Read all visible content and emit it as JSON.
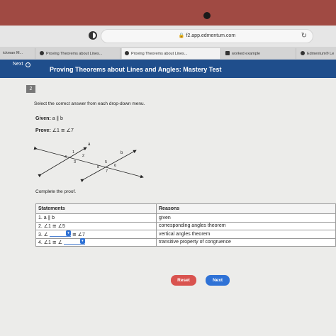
{
  "browser": {
    "url": "f2.app.edmentum.com",
    "tabs": [
      {
        "label": "ickman M...",
        "icon": "none"
      },
      {
        "label": "Proving Theorems about Lines...",
        "icon": "edmentum-icon"
      },
      {
        "label": "Proving Theorems about Lines...",
        "icon": "edmentum-icon",
        "active": true
      },
      {
        "label": "worked example",
        "icon": "doc-icon"
      },
      {
        "label": "Edmentum® Le",
        "icon": "edmentum-icon"
      }
    ]
  },
  "nav": {
    "next_label": "Next",
    "title": "Proving Theorems about Lines and Angles: Mastery Test"
  },
  "question": {
    "number": "2",
    "instruction": "Select the correct answer from each drop-down menu.",
    "given_label": "Given:",
    "given_value": "a ∥ b",
    "prove_label": "Prove:",
    "prove_value": "∠1 ≅ ∠7",
    "complete_text": "Complete the proof."
  },
  "diagram": {
    "line_labels": [
      "a",
      "b"
    ],
    "angle_labels": [
      "1",
      "2",
      "3",
      "4",
      "5",
      "6",
      "7",
      "8"
    ]
  },
  "proof": {
    "headers": [
      "Statements",
      "Reasons"
    ],
    "rows": [
      {
        "statement": "1. a ∥ b",
        "reason": "given"
      },
      {
        "statement": "2. ∠1 ≅ ∠5",
        "reason": "corresponding angles theorem"
      },
      {
        "statement_pre": "3. ∠",
        "statement_post": "≅ ∠7",
        "reason": "vertical angles theorem"
      },
      {
        "statement_pre": "4. ∠1 ≅ ∠",
        "statement_post": "",
        "reason": "transitive property of congruence"
      }
    ]
  },
  "buttons": {
    "reset": "Reset",
    "next": "Next"
  },
  "colors": {
    "nav_blue": "#1f4e8c",
    "reset_red": "#d9534f",
    "accent_blue": "#2f72d6"
  }
}
